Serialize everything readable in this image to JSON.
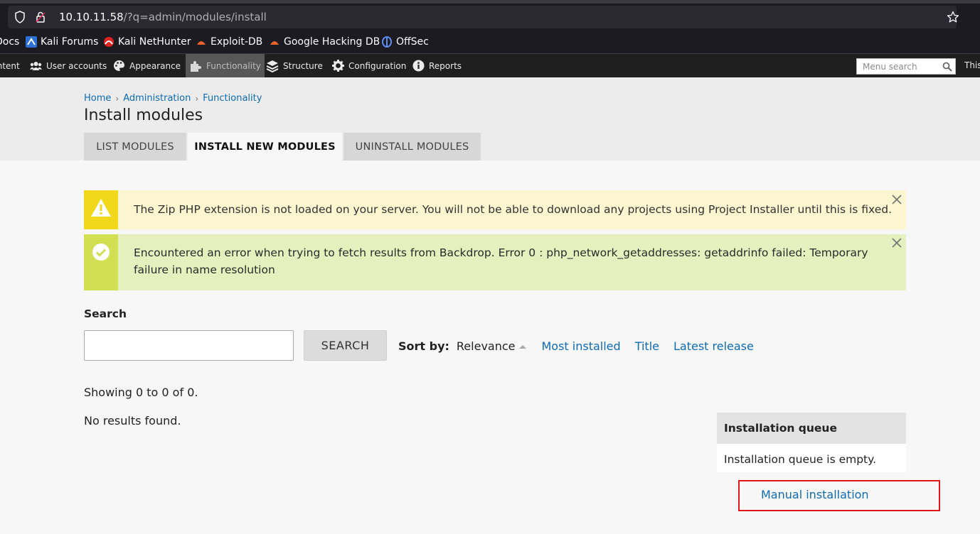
{
  "browser": {
    "url_host": "10.10.11.58",
    "url_path": "/?q=admin/modules/install",
    "bookmarks": [
      {
        "label": "Docs",
        "icon": "docs-icon"
      },
      {
        "label": "Kali Forums",
        "icon": "kali-forums-icon"
      },
      {
        "label": "Kali NetHunter",
        "icon": "nethunter-icon"
      },
      {
        "label": "Exploit-DB",
        "icon": "exploit-db-icon"
      },
      {
        "label": "Google Hacking DB",
        "icon": "ghdb-icon"
      },
      {
        "label": "OffSec",
        "icon": "offsec-icon"
      }
    ]
  },
  "adminbar": {
    "items": [
      {
        "label": "Content",
        "icon": "content-icon"
      },
      {
        "label": "User accounts",
        "icon": "users-icon"
      },
      {
        "label": "Appearance",
        "icon": "palette-icon"
      },
      {
        "label": "Functionality",
        "icon": "puzzle-icon",
        "active": true
      },
      {
        "label": "Structure",
        "icon": "layers-icon"
      },
      {
        "label": "Configuration",
        "icon": "gear-icon"
      },
      {
        "label": "Reports",
        "icon": "info-icon"
      }
    ],
    "search_placeholder": "Menu search",
    "trailing_text": "This"
  },
  "breadcrumb": [
    "Home",
    "Administration",
    "Functionality"
  ],
  "page_title": "Install modules",
  "tabs": [
    {
      "label": "LIST MODULES",
      "active": false
    },
    {
      "label": "INSTALL NEW MODULES",
      "active": true
    },
    {
      "label": "UNINSTALL MODULES",
      "active": false
    }
  ],
  "messages": {
    "warning": "The Zip PHP extension is not loaded on your server. You will not be able to download any projects using Project Installer until this is fixed.",
    "status": "Encountered an error when trying to fetch results from Backdrop. Error 0 : php_network_getaddresses: getaddrinfo failed: Temporary failure in name resolution"
  },
  "search": {
    "label": "Search",
    "value": "",
    "button": "SEARCH",
    "sort_label": "Sort by:",
    "sort_current": "Relevance",
    "sort_options": [
      "Most installed",
      "Title",
      "Latest release"
    ]
  },
  "results": {
    "showing": "Showing 0 to 0 of 0.",
    "empty": "No results found."
  },
  "queue": {
    "title": "Installation queue",
    "body": "Installation queue is empty.",
    "manual_link": "Manual installation"
  },
  "colors": {
    "link": "#0e6bb5",
    "warning_bar": "#f2d81a",
    "status_bar": "#d2df53",
    "highlight": "#e01717"
  }
}
